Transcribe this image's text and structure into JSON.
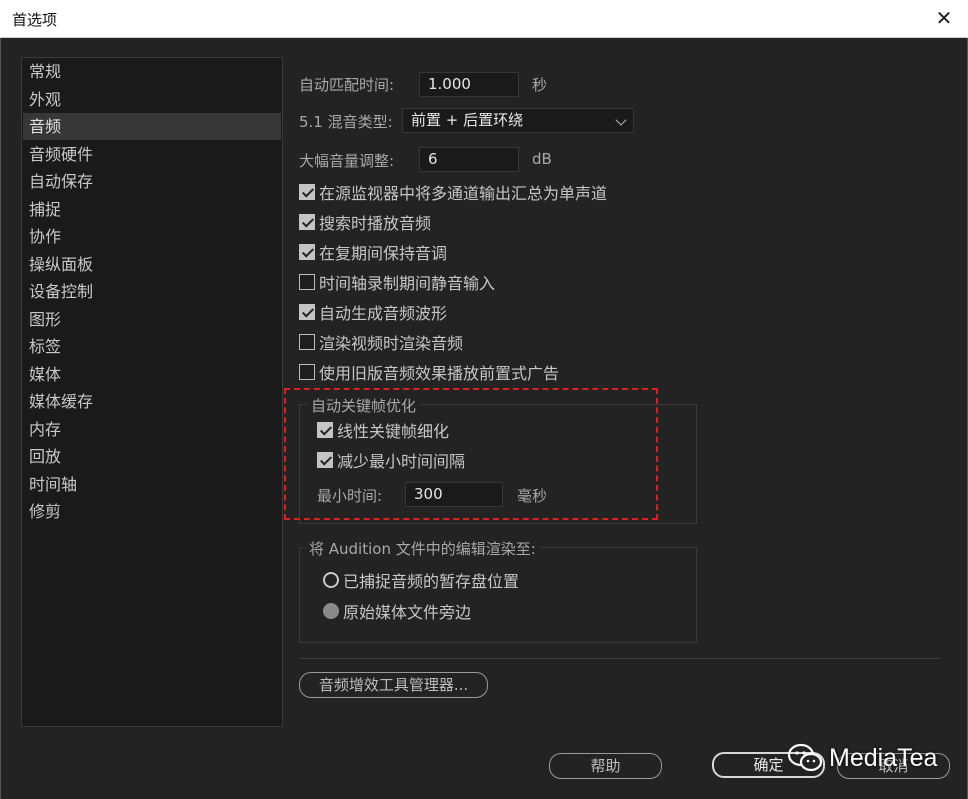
{
  "window": {
    "title": "首选项",
    "close_glyph": "✕"
  },
  "sidebar": {
    "items": [
      {
        "label": "常规"
      },
      {
        "label": "外观"
      },
      {
        "label": "音频",
        "selected": true
      },
      {
        "label": "音频硬件"
      },
      {
        "label": "自动保存"
      },
      {
        "label": "捕捉"
      },
      {
        "label": "协作"
      },
      {
        "label": "操纵面板"
      },
      {
        "label": "设备控制"
      },
      {
        "label": "图形"
      },
      {
        "label": "标签"
      },
      {
        "label": "媒体"
      },
      {
        "label": "媒体缓存"
      },
      {
        "label": "内存"
      },
      {
        "label": "回放"
      },
      {
        "label": "时间轴"
      },
      {
        "label": "修剪"
      }
    ]
  },
  "audio": {
    "auto_match": {
      "label": "自动匹配时间:",
      "value": "1.000",
      "unit": "秒"
    },
    "mix_type": {
      "label": "5.1 混音类型:",
      "value": "前置 + 后置环绕"
    },
    "volume_adjust": {
      "label": "大幅音量调整:",
      "value": "6",
      "unit": "dB"
    },
    "checkboxes": [
      {
        "label": "在源监视器中将多通道输出汇总为单声道",
        "checked": true
      },
      {
        "label": "搜索时播放音频",
        "checked": true
      },
      {
        "label": "在复期间保持音调",
        "checked": true
      },
      {
        "label": "时间轴录制期间静音输入",
        "checked": false
      },
      {
        "label": "自动生成音频波形",
        "checked": true
      },
      {
        "label": "渲染视频时渲染音频",
        "checked": false
      },
      {
        "label": "使用旧版音频效果播放前置式广告",
        "checked": false
      }
    ],
    "keyframe_group": {
      "title": "自动关键帧优化",
      "options": [
        {
          "label": "线性关键帧细化",
          "checked": true
        },
        {
          "label": "减少最小时间间隔",
          "checked": true
        }
      ],
      "min_time": {
        "label": "最小时间:",
        "value": "300",
        "unit": "毫秒"
      }
    },
    "audition_group": {
      "title": "将 Audition 文件中的编辑渲染至:",
      "options": [
        {
          "label": "已捕捉音频的暂存盘位置",
          "selected": true
        },
        {
          "label": "原始媒体文件旁边",
          "selected": false
        }
      ]
    },
    "plugin_manager_button": "音频增效工具管理器..."
  },
  "footer": {
    "help": "帮助",
    "ok": "确定",
    "cancel": "取消"
  },
  "watermark": {
    "text": "MediaTea"
  },
  "colors": {
    "highlight_dash": "#e01e1e",
    "background": "#232323",
    "sidebar_bg": "#1a1a1a"
  }
}
